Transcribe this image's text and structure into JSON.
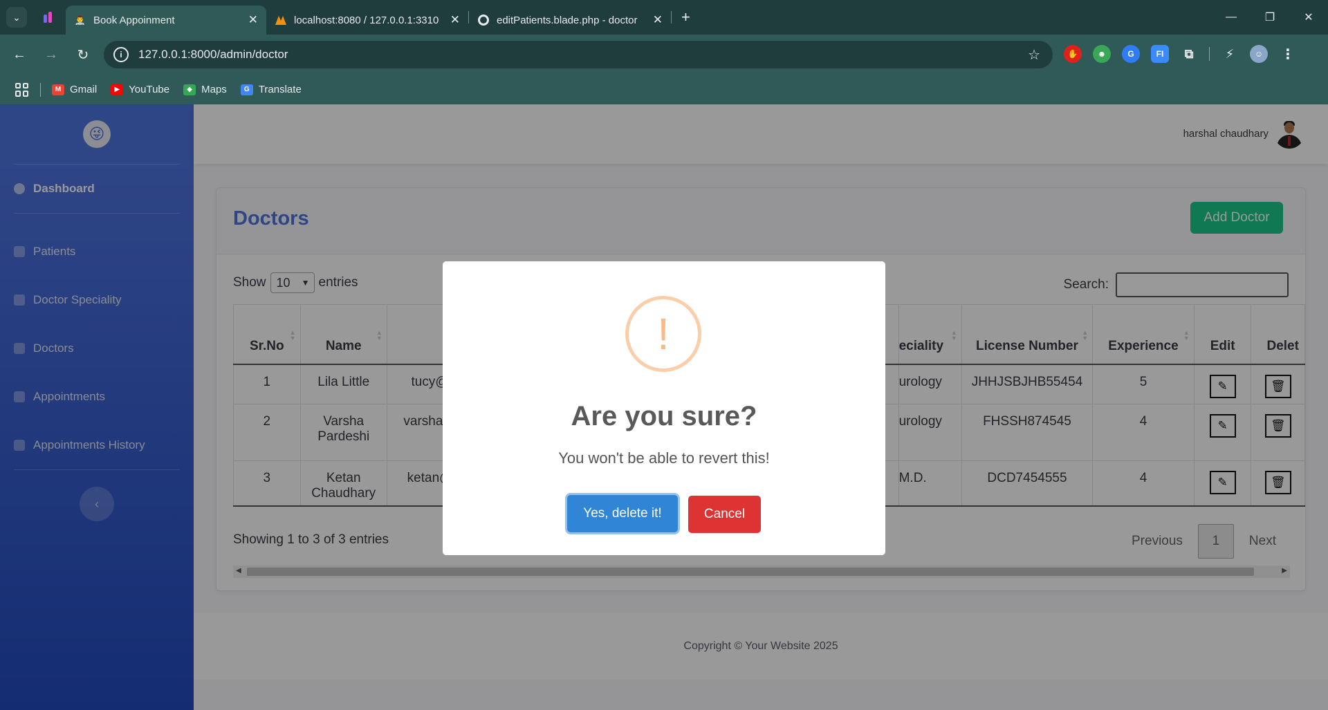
{
  "browser": {
    "tabs": [
      {
        "title": "Book Appoinment",
        "active": true
      },
      {
        "title": "localhost:8080 / 127.0.0.1:3310",
        "active": false
      },
      {
        "title": "editPatients.blade.php - doctor",
        "active": false
      }
    ],
    "url": "127.0.0.1:8000/admin/doctor",
    "bookmarks": [
      "Gmail",
      "YouTube",
      "Maps",
      "Translate"
    ]
  },
  "sidebar": {
    "items": [
      {
        "label": "Dashboard",
        "active": true
      },
      {
        "label": "Patients"
      },
      {
        "label": "Doctor Speciality"
      },
      {
        "label": "Doctors"
      },
      {
        "label": "Appointments"
      },
      {
        "label": "Appointments History"
      }
    ]
  },
  "topbar": {
    "user_name": "harshal chaudhary"
  },
  "page": {
    "title": "Doctors",
    "add_button": "Add Doctor",
    "show_label": "Show",
    "entries_value": "10",
    "entries_label": "entries",
    "search_label": "Search:",
    "info": "Showing 1 to 3 of 3 entries",
    "prev": "Previous",
    "page_num": "1",
    "next": "Next"
  },
  "table": {
    "headers": {
      "srno": "Sr.No",
      "name": "Name",
      "speciality": "eciality",
      "license": "License Number",
      "experience": "Experience",
      "edit": "Edit",
      "delete": "Delet"
    },
    "rows": [
      {
        "srno": "1",
        "name": "Lila Little",
        "email": "tucy@",
        "speciality": "urology",
        "license": "JHHJSBJHB55454",
        "experience": "5"
      },
      {
        "srno": "2",
        "name": "Varsha Pardeshi",
        "email": "varsha@",
        "speciality": "urology",
        "license": "FHSSH874545",
        "experience": "4"
      },
      {
        "srno": "3",
        "name": "Ketan Chaudhary",
        "email": "ketan@",
        "speciality": "M.D.",
        "license": "DCD7454555",
        "experience": "4"
      }
    ]
  },
  "footer": {
    "text": "Copyright © Your Website 2025"
  },
  "modal": {
    "icon": "!",
    "title": "Are you sure?",
    "text": "You won't be able to revert this!",
    "confirm": "Yes, delete it!",
    "cancel": "Cancel"
  },
  "colors": {
    "primary": "#4e73df",
    "success": "#1cc88a",
    "confirm": "#3085d6",
    "cancel": "#dd3333",
    "warning": "#f8bb86"
  }
}
